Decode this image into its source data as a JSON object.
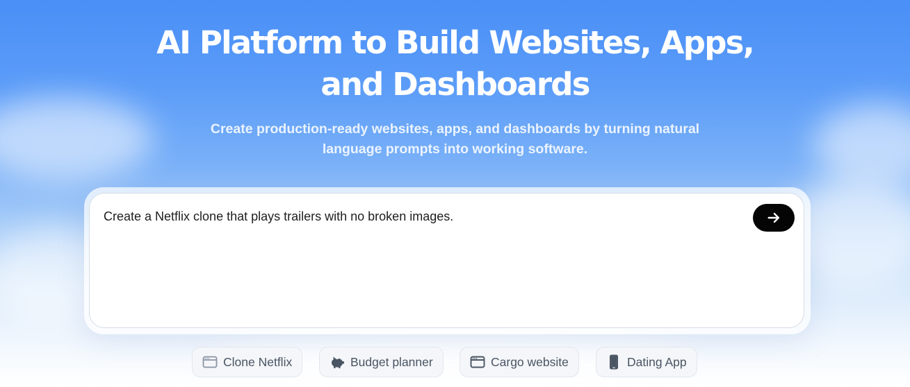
{
  "hero": {
    "title_line1": "AI Platform to Build Websites, Apps,",
    "title_line2": "and Dashboards",
    "subtitle_line1": "Create production-ready websites, apps, and dashboards by turning natural",
    "subtitle_line2": "language prompts into working software."
  },
  "prompt": {
    "value": "Create a Netflix clone that plays trailers with no broken images.",
    "send_icon": "arrow-right-icon"
  },
  "suggestions": [
    {
      "label": "Clone Netflix",
      "icon": "browser-window-icon"
    },
    {
      "label": "Budget planner",
      "icon": "piggy-bank-icon"
    },
    {
      "label": "Cargo website",
      "icon": "browser-window-icon"
    },
    {
      "label": "Dating App",
      "icon": "smartphone-icon"
    }
  ],
  "colors": {
    "sky_top": "#4a8ff7",
    "send_button": "#050505",
    "chip_text": "#4a5563"
  }
}
